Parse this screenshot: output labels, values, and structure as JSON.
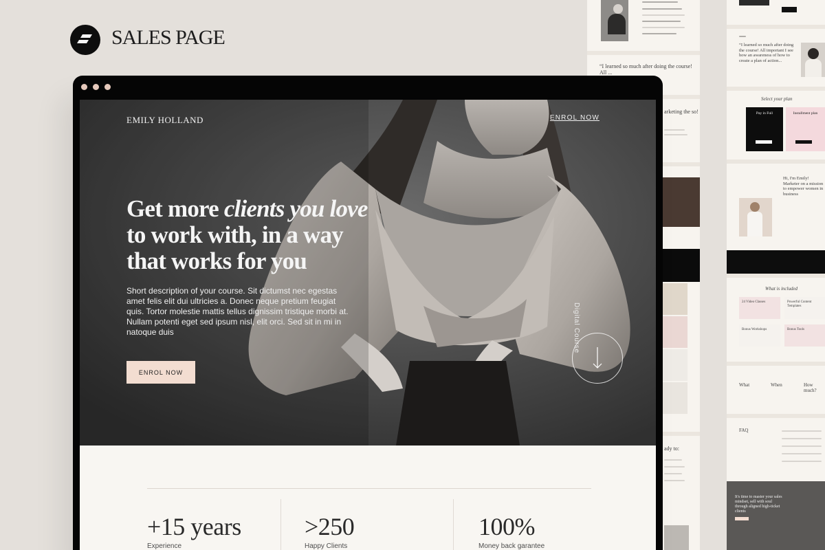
{
  "brand": {
    "title": "SALES PAGE"
  },
  "site": {
    "name": "EMILY HOLLAND",
    "nav_enrol": "ENROL NOW"
  },
  "hero": {
    "headline_start": "Get more ",
    "headline_italic": "clients you love",
    "headline_end": " to work with, in a way that works for you",
    "description": "Short description of your course. Sit dictumst nec egestas amet felis elit dui ultricies a. Donec neque pretium feugiat quis. Tortor molestie mattis tellus dignissim tristique morbi at. Nullam potenti eget sed ipsum nisl, elit orci. Sed sit in mi in natoque duis",
    "button_label": "ENROL NOW",
    "vertical_label": "Digital Course"
  },
  "stats": [
    {
      "number": "+15 years",
      "label": "Experience"
    },
    {
      "number": ">250",
      "label": "Happy Clients"
    },
    {
      "number": "100%",
      "label": "Money back garantee"
    }
  ],
  "side_pages": {
    "quote_a": "“I learned so much after doing the course! All ...",
    "quote_b": "“I learned so much after doing the course! All important I see how an awareness of how to create a plan of action...",
    "select_plan": "Select your plan",
    "plan_a": "Pay in Full",
    "plan_b": "Installment plan",
    "about_title": "Hi, I'm Emily! Marketer on a mission to empower women in business",
    "included_title": "What is included",
    "included_items": [
      "24 Video Classes",
      "Powerful Content Templates",
      "Bonus Workshops",
      "Bonus Tools"
    ],
    "what": "What",
    "when": "When",
    "how_much": "How much?",
    "faq": "FAQ",
    "cta_text": "It's time to master your sales mindset, sell with soul through aligned high-ticket clients",
    "marketing_snippet": "arketing the so!",
    "ready_snippet": "ady to:"
  }
}
